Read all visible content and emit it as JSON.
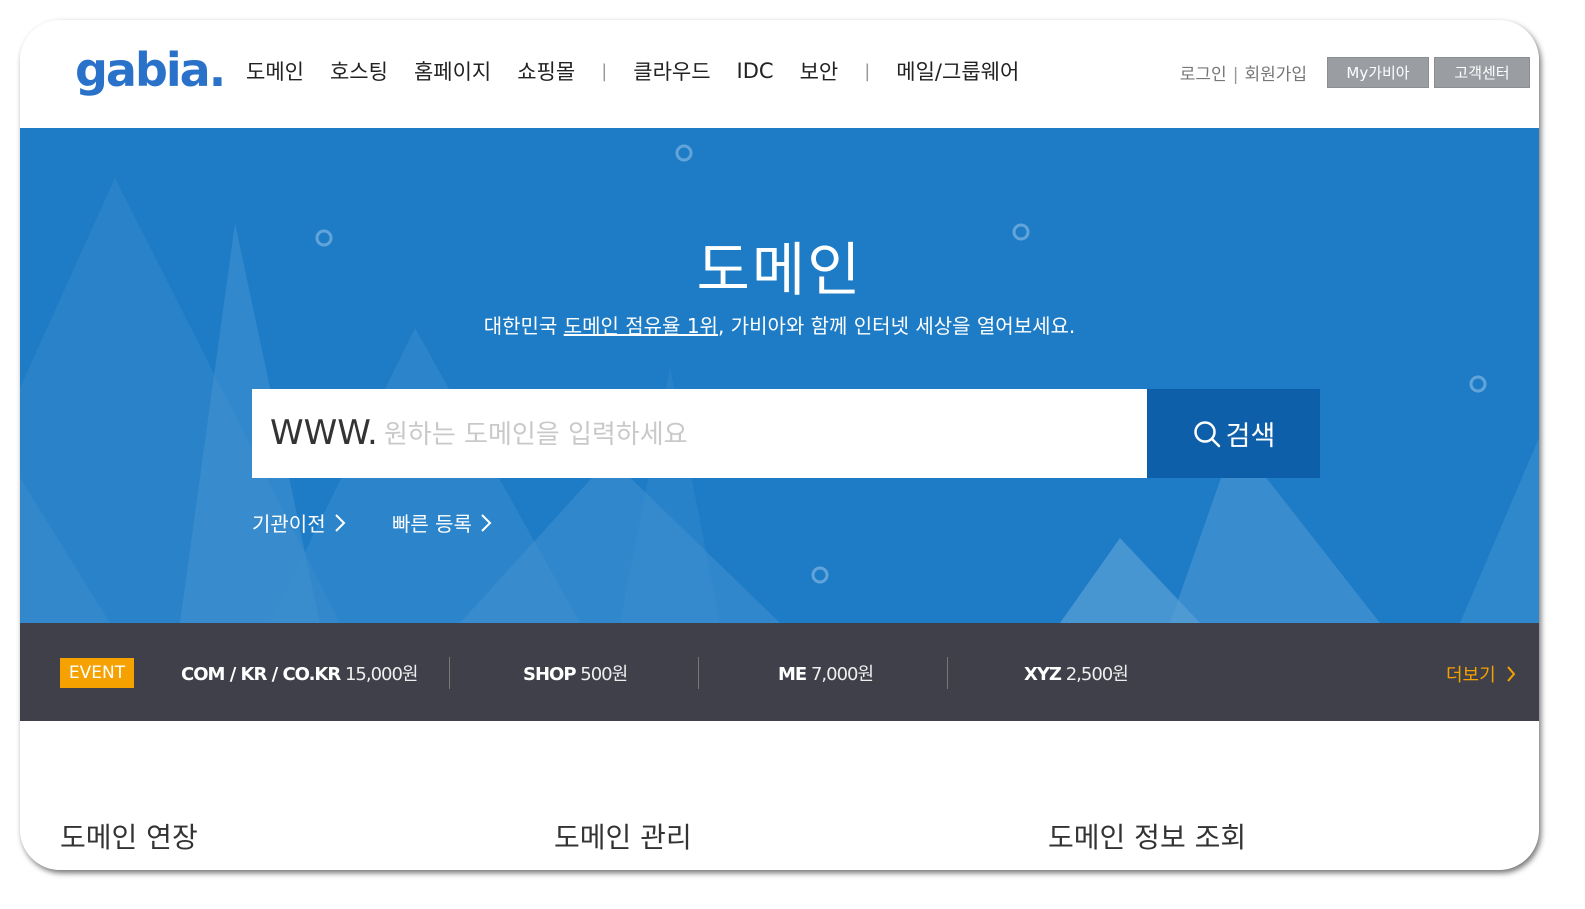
{
  "header": {
    "logo": "gabia.",
    "nav": [
      {
        "label": "도메인"
      },
      {
        "label": "호스팅"
      },
      {
        "label": "홈페이지"
      },
      {
        "label": "쇼핑몰"
      },
      {
        "label": "클라우드"
      },
      {
        "label": "IDC"
      },
      {
        "label": "보안"
      },
      {
        "label": "메일/그룹웨어"
      }
    ],
    "login": "로그인",
    "signup": "회원가입",
    "my_button": "My가비아",
    "cs_button": "고객센터"
  },
  "hero": {
    "title": "도메인",
    "subtitle_pre": "대한민국 ",
    "subtitle_link": "도메인 점유율 1위",
    "subtitle_post": ", 가비아와 함께 인터넷 세상을 열어보세요.",
    "www_prefix": "WWW.",
    "search_placeholder": "원하는 도메인을 입력하세요",
    "search_button": "검색",
    "links": [
      {
        "label": "기관이전"
      },
      {
        "label": "빠른 등록"
      }
    ],
    "colors": {
      "background": "#1e7cc6",
      "search_button": "#0d5faa"
    }
  },
  "event_bar": {
    "badge": "EVENT",
    "items": [
      {
        "name": "COM / KR / CO.KR",
        "price": "15,000원"
      },
      {
        "name": "SHOP",
        "price": "500원"
      },
      {
        "name": "ME",
        "price": "7,000원"
      },
      {
        "name": "XYZ",
        "price": "2,500원"
      }
    ],
    "more": "더보기",
    "colors": {
      "badge": "#f5a100",
      "background": "#3f4049"
    }
  },
  "sections": [
    {
      "title": "도메인 연장"
    },
    {
      "title": "도메인 관리"
    },
    {
      "title": "도메인 정보 조회"
    }
  ]
}
